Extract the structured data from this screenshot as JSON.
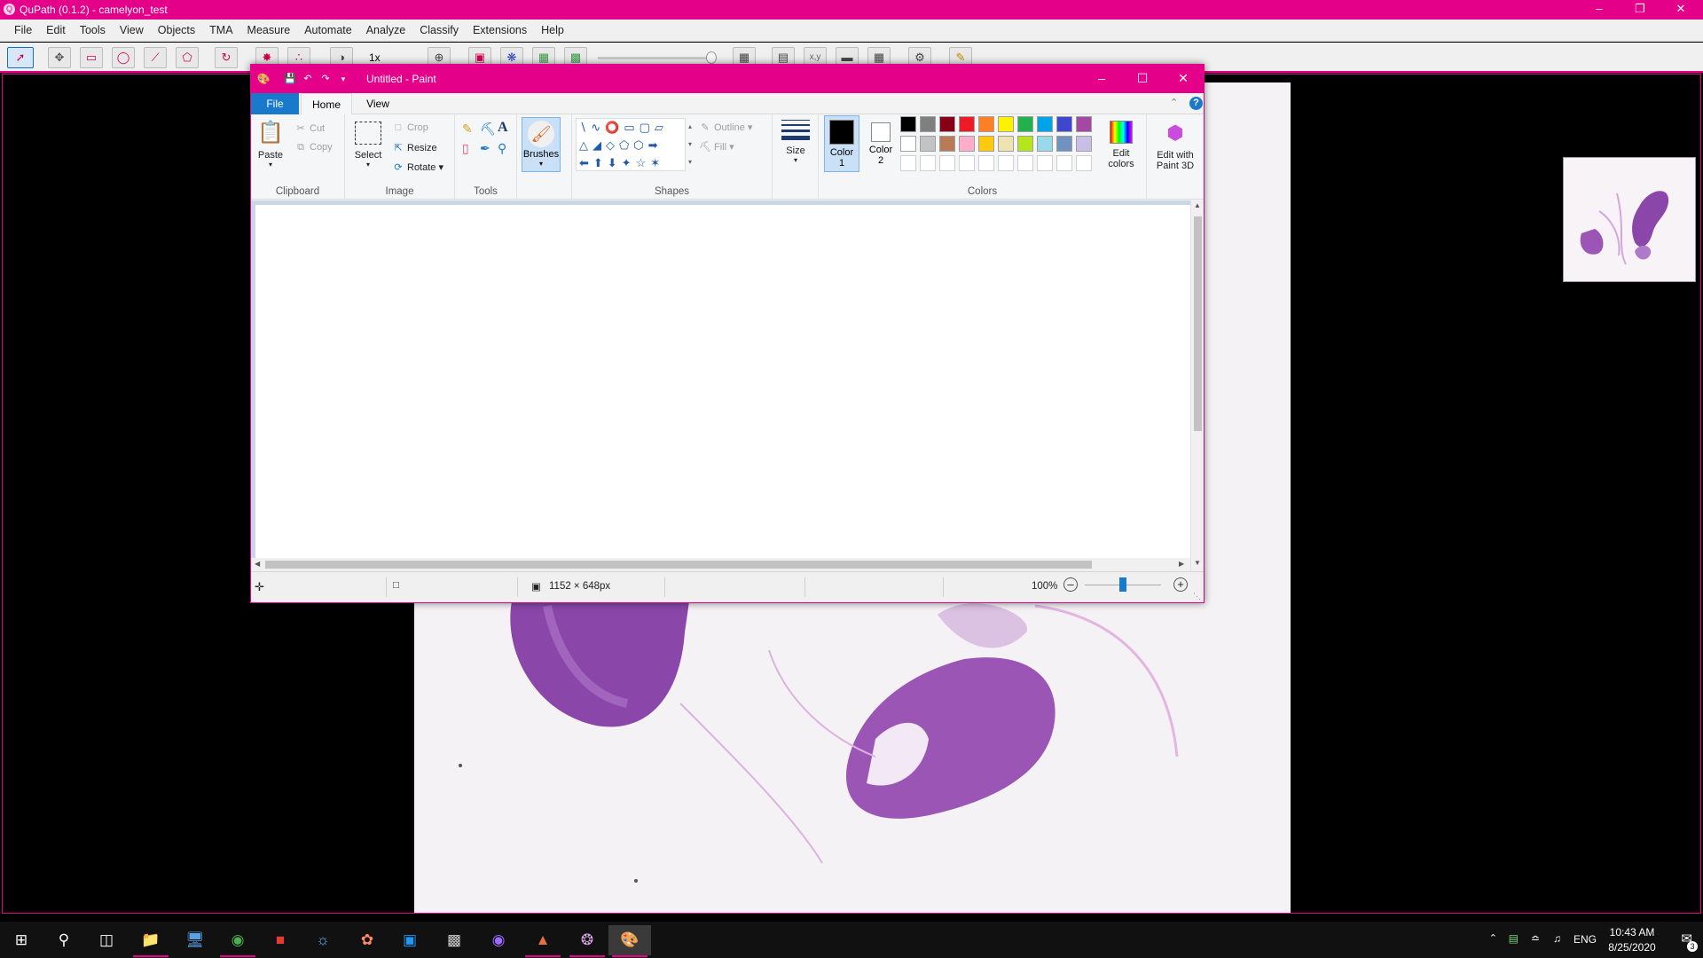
{
  "qupath": {
    "title": "QuPath (0.1.2) - camelyon_test",
    "menu": [
      "File",
      "Edit",
      "Tools",
      "View",
      "Objects",
      "TMA",
      "Measure",
      "Automate",
      "Analyze",
      "Classify",
      "Extensions",
      "Help"
    ],
    "zoom_label": "1x"
  },
  "paint": {
    "title": "Untitled - Paint",
    "tabs": {
      "file": "File",
      "home": "Home",
      "view": "View"
    },
    "clipboard": {
      "paste": "Paste",
      "cut": "Cut",
      "copy": "Copy",
      "label": "Clipboard"
    },
    "image": {
      "select": "Select",
      "crop": "Crop",
      "resize": "Resize",
      "rotate": "Rotate",
      "label": "Image"
    },
    "tools": {
      "label": "Tools"
    },
    "brushes": "Brushes",
    "shapes": {
      "outline": "Outline",
      "fill": "Fill",
      "label": "Shapes"
    },
    "size": "Size",
    "color1": {
      "line1": "Color",
      "line2": "1"
    },
    "color2": {
      "line1": "Color",
      "line2": "2"
    },
    "colors_label": "Colors",
    "edit_colors": {
      "line1": "Edit",
      "line2": "colors"
    },
    "paint3d": {
      "line1": "Edit with",
      "line2": "Paint 3D"
    },
    "palette_row1": [
      "#000000",
      "#7f7f7f",
      "#880015",
      "#ed1c24",
      "#ff7f27",
      "#fff200",
      "#22b14c",
      "#00a2e8",
      "#3f48cc",
      "#a349a4"
    ],
    "palette_row2": [
      "#ffffff",
      "#c3c3c3",
      "#b97a57",
      "#ffaec9",
      "#ffc90e",
      "#efe4b0",
      "#b5e61d",
      "#99d9ea",
      "#7092be",
      "#c8bfe7"
    ],
    "status": {
      "dimensions": "1152 × 648px",
      "zoom": "100%"
    }
  },
  "taskbar": {
    "lang": "ENG",
    "time": "10:43 AM",
    "date": "8/25/2020",
    "notif_count": "3"
  }
}
